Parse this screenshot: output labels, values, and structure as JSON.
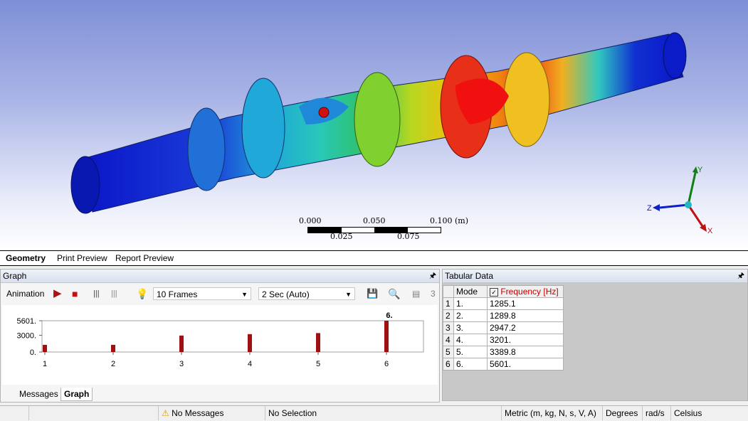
{
  "scale_bar": {
    "top_labels": [
      "0.000",
      "0.050",
      "0.100 (m)"
    ],
    "bottom_labels": [
      "0.025",
      "0.075"
    ]
  },
  "axes_triad": {
    "x": "X",
    "y": "Y",
    "z": "Z"
  },
  "view_tabs": [
    "Geometry",
    "Print Preview",
    "Report Preview"
  ],
  "graph_panel": {
    "title": "Graph",
    "animation_label": "Animation",
    "frames_select": "10 Frames",
    "time_select": "2 Sec (Auto)",
    "toolbar_extra": "3"
  },
  "chart_data": {
    "type": "bar",
    "categories": [
      "1",
      "2",
      "3",
      "4",
      "5",
      "6"
    ],
    "values": [
      1285.1,
      1289.8,
      2947.2,
      3201.0,
      3389.8,
      5601.0
    ],
    "ytick_labels": [
      "5601.",
      "3000.",
      "0."
    ],
    "yticks": [
      5601,
      3000,
      0
    ],
    "ylim": [
      0,
      5601
    ],
    "highlight_label": "6.",
    "bar_color": "#a01010",
    "grid": false
  },
  "bottom_tabs": [
    "Messages",
    "Graph"
  ],
  "tabular_panel": {
    "title": "Tabular Data",
    "columns": [
      "Mode",
      "Frequency [Hz]"
    ],
    "rows": [
      [
        "1",
        "1.",
        "1285.1"
      ],
      [
        "2",
        "2.",
        "1289.8"
      ],
      [
        "3",
        "3.",
        "2947.2"
      ],
      [
        "4",
        "4.",
        "3201."
      ],
      [
        "5",
        "5.",
        "3389.8"
      ],
      [
        "6",
        "6.",
        "5601."
      ]
    ]
  },
  "status_bar": {
    "messages": "No Messages",
    "selection": "No Selection",
    "units": "Metric (m, kg, N, s, V, A)",
    "angle": "Degrees",
    "rate": "rad/s",
    "temperature": "Celsius"
  },
  "colors": {
    "contour_low": "#0a14c8",
    "contour_high": "#e81010",
    "bar": "#a01010",
    "frequency_header": "#c00000"
  }
}
